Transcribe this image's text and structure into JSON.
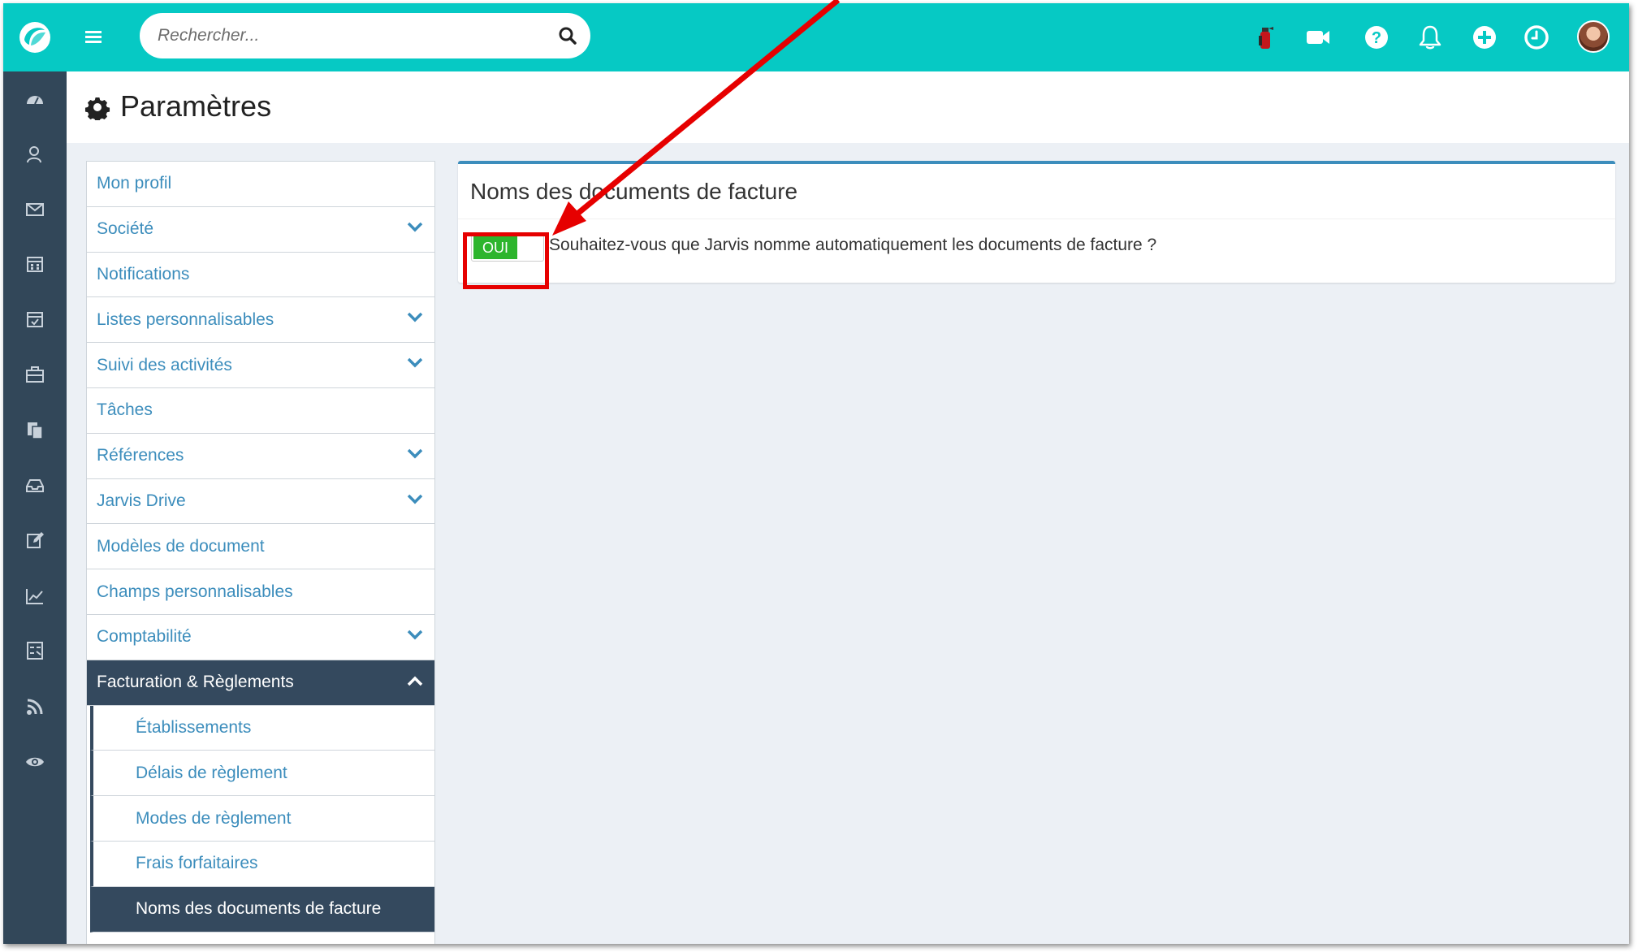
{
  "search": {
    "placeholder": "Rechercher..."
  },
  "page": {
    "title": "Paramètres"
  },
  "settings_menu": {
    "items": [
      {
        "label": "Mon profil",
        "expandable": false
      },
      {
        "label": "Société",
        "expandable": true
      },
      {
        "label": "Notifications",
        "expandable": false
      },
      {
        "label": "Listes personnalisables",
        "expandable": true
      },
      {
        "label": "Suivi des activités",
        "expandable": true
      },
      {
        "label": "Tâches",
        "expandable": false
      },
      {
        "label": "Références",
        "expandable": true
      },
      {
        "label": "Jarvis Drive",
        "expandable": true
      },
      {
        "label": "Modèles de document",
        "expandable": false
      },
      {
        "label": "Champs personnalisables",
        "expandable": false
      },
      {
        "label": "Comptabilité",
        "expandable": true
      },
      {
        "label": "Facturation & Règlements",
        "expandable": true,
        "expanded": true,
        "active": true
      }
    ],
    "sub_items": [
      {
        "label": "Établissements"
      },
      {
        "label": "Délais de règlement"
      },
      {
        "label": "Modes de règlement"
      },
      {
        "label": "Frais forfaitaires"
      },
      {
        "label": "Noms des documents de facture",
        "active": true
      }
    ]
  },
  "card": {
    "title": "Noms des documents de facture",
    "toggle_label": "OUI",
    "toggle_on": true,
    "question": "Souhaitez-vous que Jarvis nomme automatiquement les documents de facture ?"
  },
  "colors": {
    "topbar": "#06c9c4",
    "sidebar": "#324759",
    "active_menu": "#34495e",
    "link": "#3c8dbc",
    "toggle_on": "#2db52d",
    "annotation": "#e60000"
  },
  "icons": {
    "top": [
      "logo-icon",
      "menu-icon",
      "search-icon",
      "fire-extinguisher-icon",
      "video-camera-icon",
      "help-icon",
      "bell-icon",
      "add-circle-icon",
      "clock-icon",
      "avatar"
    ],
    "sidebar": [
      "dashboard-icon",
      "contacts-icon",
      "mail-icon",
      "calendar-icon",
      "calendar-check-icon",
      "briefcase-icon",
      "documents-icon",
      "inbox-icon",
      "edit-icon",
      "chart-icon",
      "calculator-icon",
      "rss-icon",
      "eye-icon"
    ]
  }
}
